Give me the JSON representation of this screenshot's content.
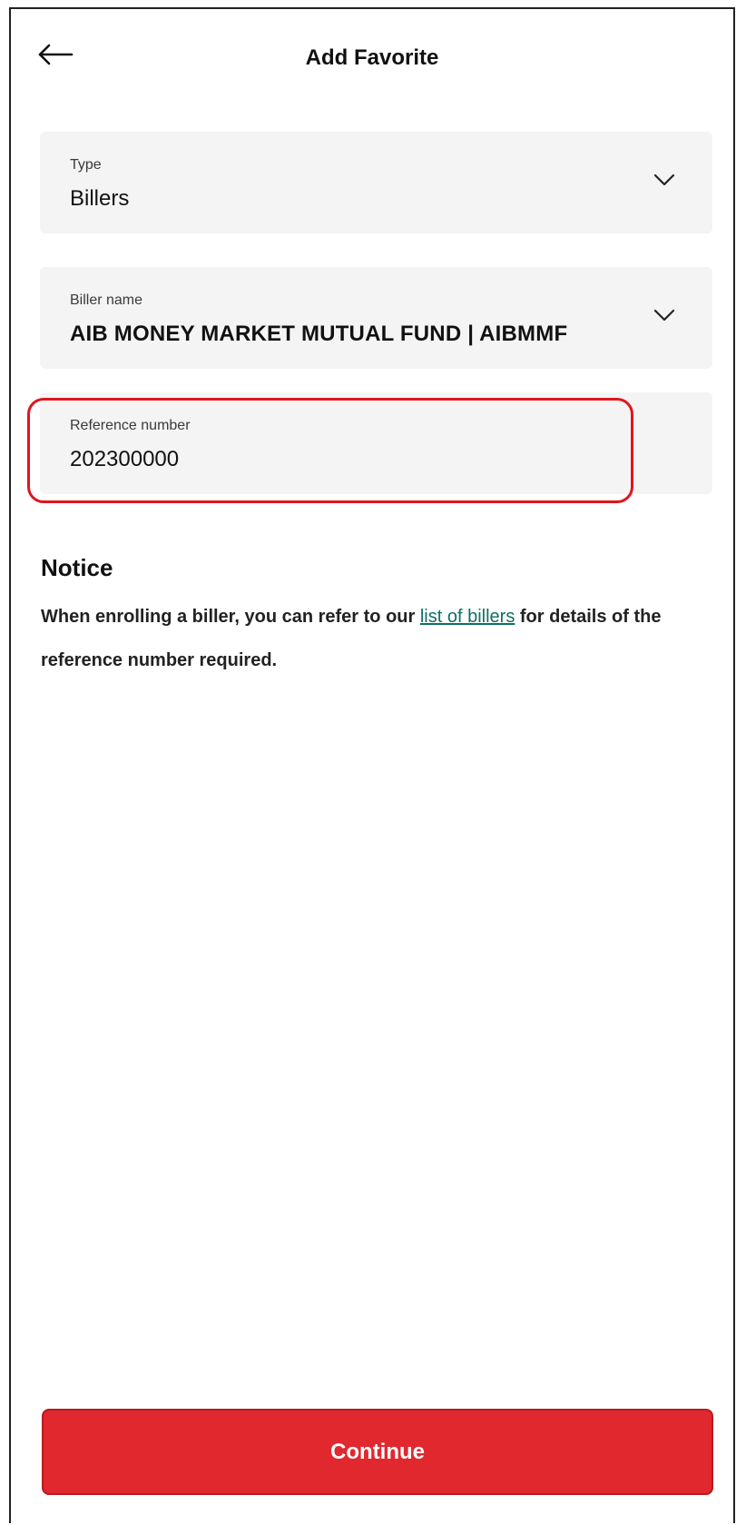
{
  "header": {
    "title": "Add Favorite",
    "back_icon": "arrow-left-icon"
  },
  "type_field": {
    "label": "Type",
    "value": "Billers",
    "icon": "chevron-down-icon"
  },
  "biller_field": {
    "label": "Biller name",
    "value": "AIB MONEY MARKET MUTUAL FUND | AIBMMF",
    "icon": "chevron-down-icon"
  },
  "reference_field": {
    "label": "Reference number",
    "value": "202300000"
  },
  "notice": {
    "title": "Notice",
    "text_before": "When enrolling a biller, you can refer to our ",
    "link_text": "list of billers",
    "text_after": " for details of the reference number required."
  },
  "actions": {
    "continue_label": "Continue"
  },
  "colors": {
    "primary": "#e0282e",
    "highlight": "#e0161d",
    "link": "#0f6f62",
    "field_bg": "#f4f4f4"
  }
}
